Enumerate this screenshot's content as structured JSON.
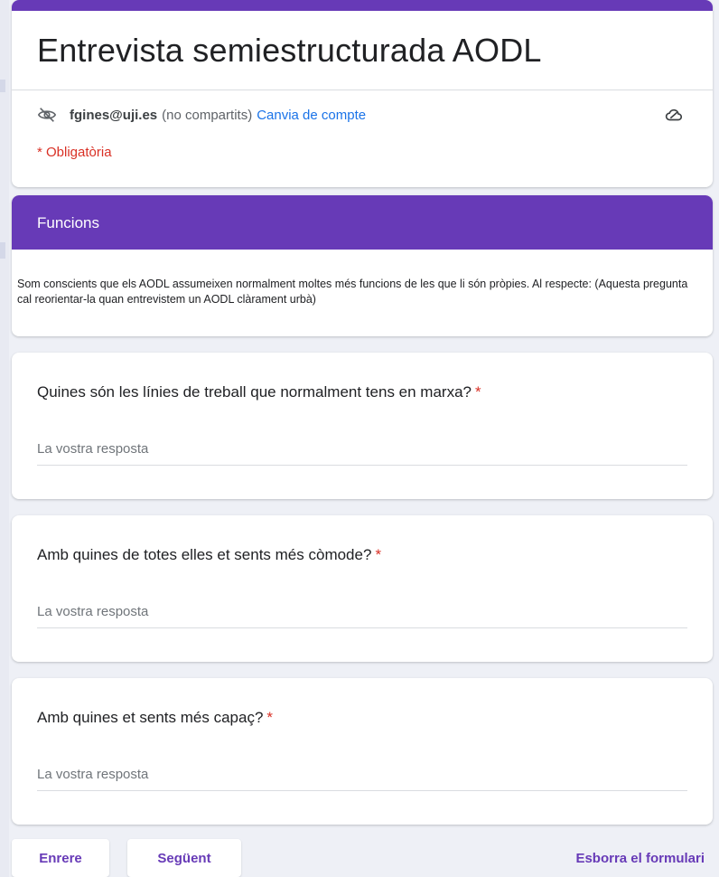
{
  "form": {
    "title": "Entrevista semiestructurada AODL",
    "account_email": "fgines@uji.es",
    "account_note": "(no compartits)",
    "switch_account": "Canvia de compte",
    "required_note": "* Obligatòria",
    "icons": {
      "privacy": "eye-off-icon",
      "save": "cloud-icon"
    }
  },
  "section": {
    "title": "Funcions",
    "description": "Som conscients que els AODL assumeixen normalment moltes més funcions de les que li són pròpies. Al respecte: (Aquesta pregunta cal reorientar-la quan entrevistem un AODL clàrament urbà)"
  },
  "questions": [
    {
      "title": "Quines són les línies de treball que normalment tens en marxa?",
      "required_mark": "*",
      "placeholder": "La vostra resposta"
    },
    {
      "title": "Amb quines de totes elles et sents més còmode?",
      "required_mark": "*",
      "placeholder": "La vostra resposta"
    },
    {
      "title": "Amb quines et sents més capaç?",
      "required_mark": "*",
      "placeholder": "La vostra resposta"
    }
  ],
  "nav": {
    "back_label": "Enrere",
    "next_label": "Següent",
    "clear_label": "Esborra el formulari"
  },
  "colors": {
    "accent": "#673ab7",
    "link": "#1a73e8",
    "required": "#d93025",
    "background": "#eef0f6"
  }
}
